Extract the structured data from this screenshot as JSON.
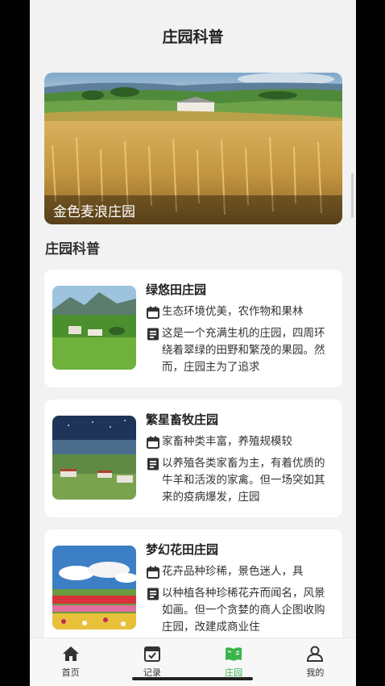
{
  "header": {
    "title": "庄园科普"
  },
  "hero": {
    "caption": "金色麦浪庄园"
  },
  "section": {
    "title": "庄园科普"
  },
  "cards": [
    {
      "title": "绿悠田庄园",
      "features": "生态环境优美，农作物和果林",
      "description": "这是一个充满生机的庄园，四周环绕着翠绿的田野和繁茂的果园。然而，庄园主为了追求"
    },
    {
      "title": "繁星畜牧庄园",
      "features": "家畜种类丰富，养殖规模较",
      "description": "以养殖各类家畜为主，有着优质的牛羊和活泼的家禽。但一场突如其来的疫病爆发，庄园"
    },
    {
      "title": "梦幻花田庄园",
      "features": "花卉品种珍稀，景色迷人，具",
      "description": "以种植各种珍稀花卉而闻名，风景如画。但一个贪婪的商人企图收购庄园，改建成商业住"
    }
  ],
  "tabs": [
    {
      "label": "首页",
      "icon": "home-icon"
    },
    {
      "label": "记录",
      "icon": "record-icon"
    },
    {
      "label": "庄园",
      "icon": "book-icon",
      "active": true
    },
    {
      "label": "我的",
      "icon": "profile-icon"
    }
  ],
  "colors": {
    "accent": "#3ab54a",
    "background": "#f2f2f2"
  }
}
